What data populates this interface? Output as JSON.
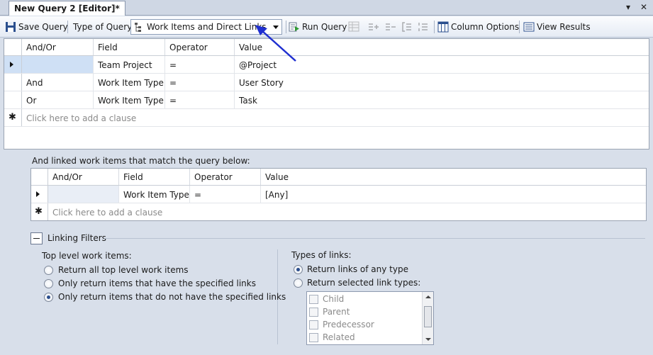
{
  "window": {
    "tab_title": "New Query 2 [Editor]*"
  },
  "toolbar": {
    "save_label": "Save Query",
    "type_label": "Type of Query:",
    "type_value": "Work Items and Direct Links",
    "run_label": "Run Query",
    "column_options_label": "Column Options",
    "view_results_label": "View Results"
  },
  "query_grid": {
    "columns": [
      "And/Or",
      "Field",
      "Operator",
      "Value"
    ],
    "rows": [
      {
        "andor": "",
        "field": "Team Project",
        "operator": "=",
        "value": "@Project"
      },
      {
        "andor": "And",
        "field": "Work Item Type",
        "operator": "=",
        "value": "User Story"
      },
      {
        "andor": "Or",
        "field": "Work Item Type",
        "operator": "=",
        "value": "Task"
      }
    ],
    "add_clause": "Click here to add a clause"
  },
  "linked": {
    "heading": "And linked work items that match the query below:",
    "columns": [
      "And/Or",
      "Field",
      "Operator",
      "Value"
    ],
    "rows": [
      {
        "andor": "",
        "field": "Work Item Type",
        "operator": "=",
        "value": "[Any]"
      }
    ],
    "add_clause": "Click here to add a clause"
  },
  "filters": {
    "title": "Linking Filters",
    "top_level_heading": "Top level work items:",
    "top_level_options": [
      "Return all top level work items",
      "Only return items that have the specified links",
      "Only return items that do not have the specified links"
    ],
    "top_level_selected": 2,
    "types_heading": "Types of links:",
    "types_options": [
      "Return links of any type",
      "Return selected link types:"
    ],
    "types_selected": 0,
    "link_types": [
      "Child",
      "Parent",
      "Predecessor",
      "Related"
    ]
  },
  "colors": {
    "accent_arrow": "#1f2fd0",
    "selected_row": "#cfe0f5"
  }
}
